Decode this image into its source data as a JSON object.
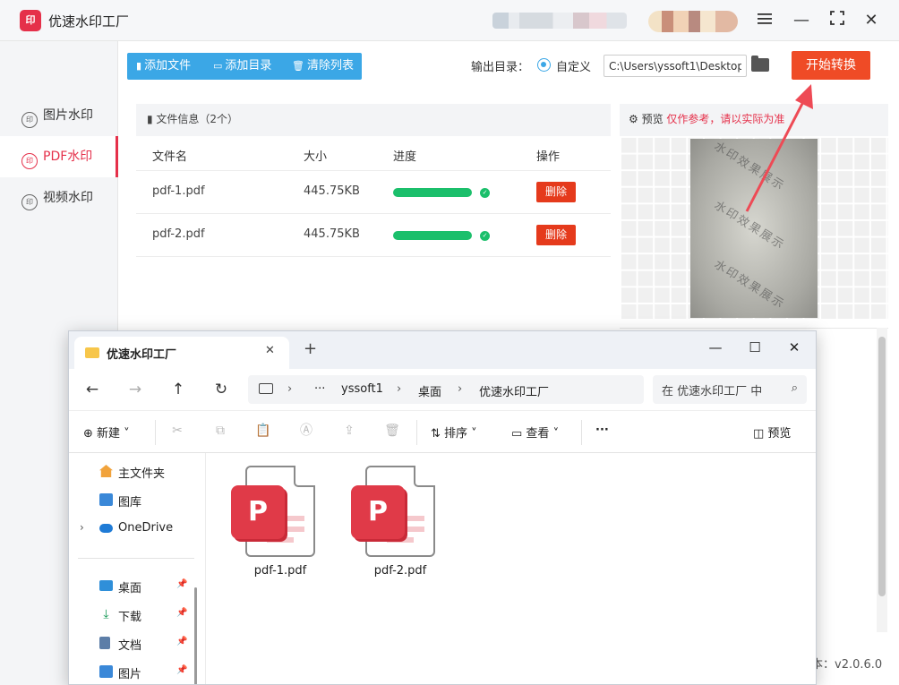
{
  "app": {
    "logo_text": "印",
    "title": "优速水印工厂"
  },
  "window": {
    "menu_icon": "hamburger-icon",
    "minimize": "—",
    "maximize": "⤢",
    "close": "✕"
  },
  "sidebar": {
    "items": [
      {
        "icon_text": "印",
        "label": "图片水印",
        "active": false
      },
      {
        "icon_text": "印",
        "label": "PDF水印",
        "active": true
      },
      {
        "icon_text": "印",
        "label": "视频水印",
        "active": false
      }
    ]
  },
  "toolbar": {
    "add_file": "添加文件",
    "add_dir": "添加目录",
    "clear_list": "清除列表",
    "output_label": "输出目录：",
    "custom_label": "自定义",
    "output_path": "C:\\Users\\yssoft1\\Desktop",
    "start": "开始转换"
  },
  "file_panel": {
    "header": "文件信息（2个）",
    "columns": [
      "文件名",
      "大小",
      "进度",
      "操作"
    ],
    "rows": [
      {
        "name": "pdf-1.pdf",
        "size": "445.75KB",
        "progress": 1.0,
        "action": "删除"
      },
      {
        "name": "pdf-2.pdf",
        "size": "445.75KB",
        "progress": 1.0,
        "action": "删除"
      }
    ]
  },
  "preview": {
    "label": "预览",
    "note": "仅作参考，请以实际为准",
    "watermark_text": "水印效果展示"
  },
  "version": "本：v2.0.6.0",
  "explorer": {
    "tab_title": "优速水印工厂",
    "tab_close": "✕",
    "new_tab": "+",
    "min": "—",
    "max": "☐",
    "close": "✕",
    "nav": {
      "back": "←",
      "forward": "→",
      "up": "↑",
      "refresh": "↻"
    },
    "breadcrumb": [
      "···",
      "yssoft1",
      "桌面",
      "优速水印工厂"
    ],
    "search_placeholder": "在 优速水印工厂 中",
    "commands": {
      "new": "新建",
      "sort": "排序",
      "view": "查看",
      "more": "···",
      "preview": "预览"
    },
    "tree": [
      {
        "label": "主文件夹",
        "icon": "home-icon",
        "pinned": false
      },
      {
        "label": "图库",
        "icon": "gallery-icon",
        "pinned": false
      },
      {
        "label": "OneDrive",
        "icon": "cloud-icon",
        "pinned": false
      },
      {
        "label": "桌面",
        "icon": "desktop-icon",
        "pinned": true
      },
      {
        "label": "下载",
        "icon": "download-icon",
        "pinned": true
      },
      {
        "label": "文档",
        "icon": "document-icon",
        "pinned": true
      },
      {
        "label": "图片",
        "icon": "picture-icon",
        "pinned": true
      }
    ],
    "files": [
      {
        "name": "pdf-1.pdf",
        "icon": "pdf-file-icon"
      },
      {
        "name": "pdf-2.pdf",
        "icon": "pdf-file-icon"
      }
    ]
  },
  "colors": {
    "accent": "#e5304a",
    "toolbar_blue": "#3ba7e6",
    "start_button": "#ef4b26",
    "progress": "#1bbf6b",
    "delete_button": "#e53a1c"
  }
}
